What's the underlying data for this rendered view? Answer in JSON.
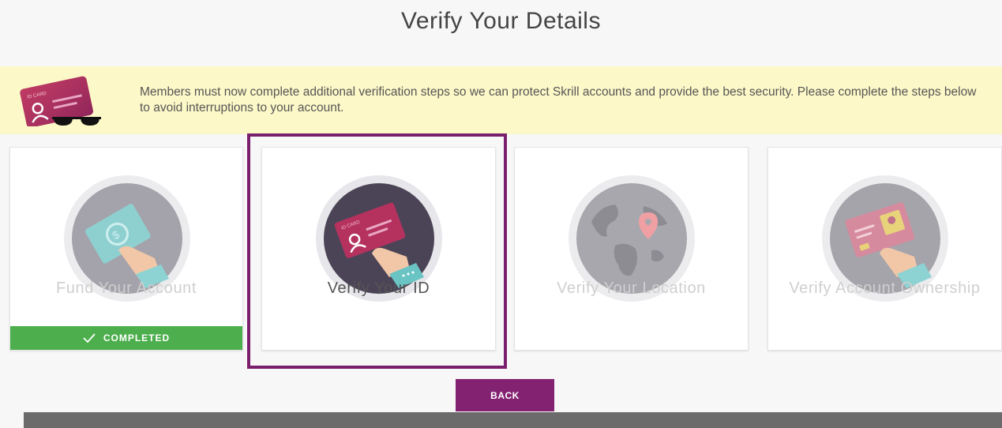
{
  "page": {
    "title": "Verify Your Details"
  },
  "notice": {
    "text": "Members must now complete additional verification steps so we can protect Skrill accounts and provide the best security. Please complete the steps below to avoid interruptions to your account.",
    "icon": "id-card-sunglasses-icon",
    "card_label": "ID CARD"
  },
  "steps": [
    {
      "title": "Fund Your Account",
      "status": "COMPLETED",
      "icon": "cash-hand-icon"
    },
    {
      "title": "Verify Your ID",
      "status": "active",
      "icon": "id-card-hand-icon",
      "card_label": "ID CARD"
    },
    {
      "title": "Verify Your Location",
      "status": "pending",
      "icon": "globe-pin-icon"
    },
    {
      "title": "Verify Account Ownership",
      "status": "pending",
      "icon": "card-hand-icon"
    }
  ],
  "actions": {
    "back_label": "BACK"
  },
  "colors": {
    "brand": "#842272",
    "highlight": "#7a1e6e",
    "completed": "#4cae4c",
    "notice_bg": "#fdf8c8"
  }
}
